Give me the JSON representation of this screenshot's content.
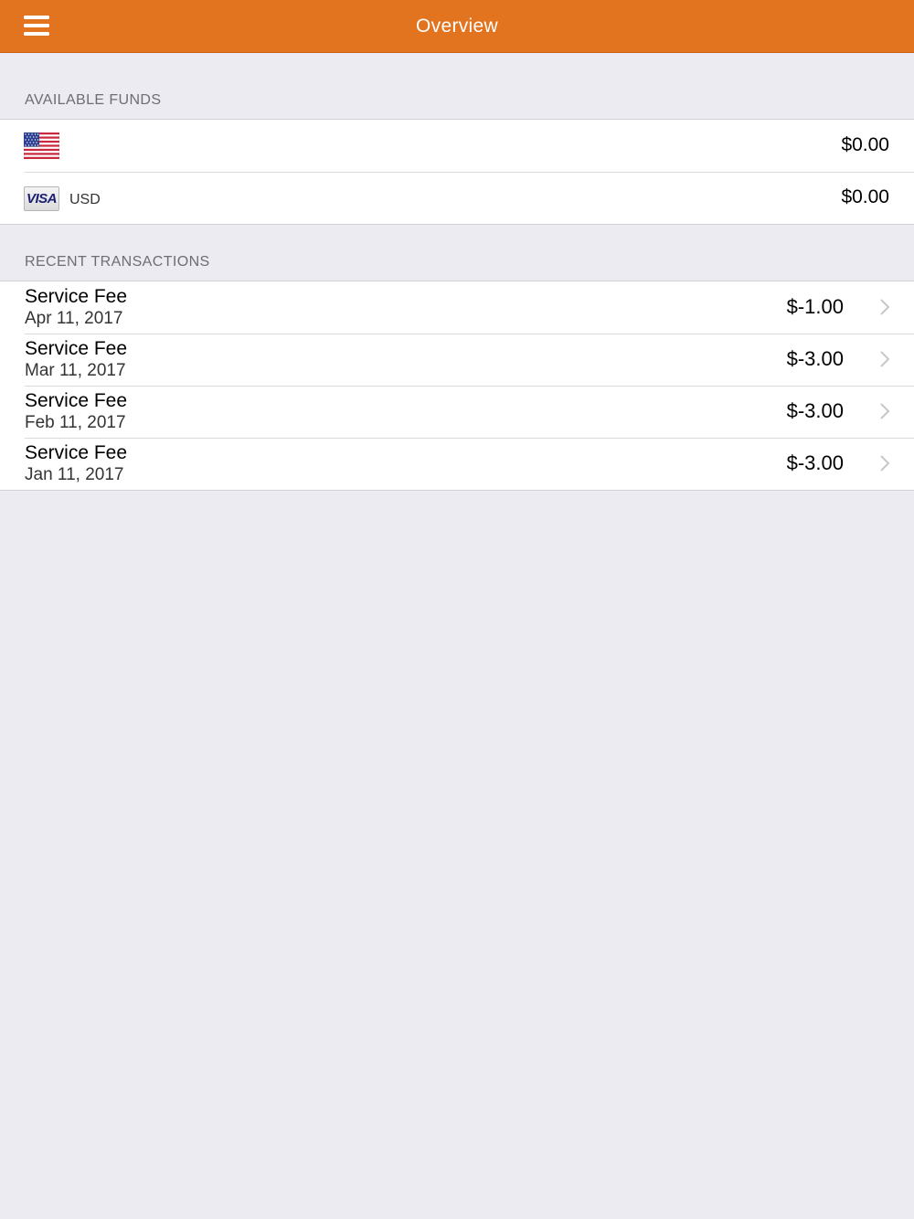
{
  "navbar": {
    "title": "Overview",
    "menu_icon": "hamburger-menu-icon",
    "color": "#e2731f"
  },
  "available_funds": {
    "header": "AVAILABLE FUNDS",
    "items": [
      {
        "icon": "us-flag-icon",
        "currency": "",
        "amount": "$0.00"
      },
      {
        "icon": "visa-card-icon",
        "icon_text": "VISA",
        "currency": "USD",
        "amount": "$0.00"
      }
    ]
  },
  "recent_transactions": {
    "header": "RECENT TRANSACTIONS",
    "items": [
      {
        "title": "Service Fee",
        "date": "Apr 11, 2017",
        "amount": "$-1.00"
      },
      {
        "title": "Service Fee",
        "date": "Mar 11, 2017",
        "amount": "$-3.00"
      },
      {
        "title": "Service Fee",
        "date": "Feb 11, 2017",
        "amount": "$-3.00"
      },
      {
        "title": "Service Fee",
        "date": "Jan 11, 2017",
        "amount": "$-3.00"
      }
    ]
  }
}
